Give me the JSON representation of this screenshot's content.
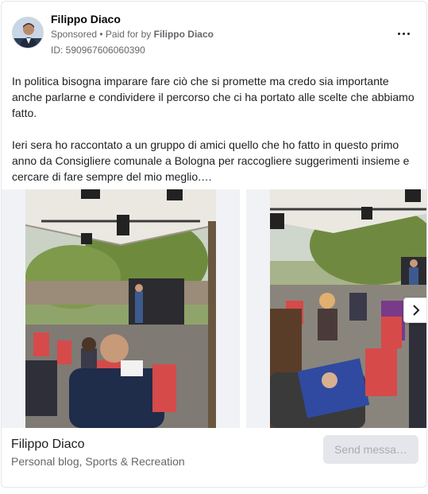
{
  "header": {
    "page_name": "Filippo Diaco",
    "sponsored_label": "Sponsored",
    "separator": " • ",
    "paid_for_prefix": "Paid for by ",
    "paid_for_name": "Filippo Diaco",
    "ad_id": "ID: 590967606060390",
    "more_icon": "more-horizontal-icon"
  },
  "post": {
    "paragraph_1": "In politica bisogna imparare fare ciò che si promette ma credo sia importante anche parlarne e condividere il percorso che ci ha portato alle scelte che abbiamo fatto.",
    "paragraph_2": "Ieri sera ho raccontato a un gruppo di amici quello che ho fatto in questo primo anno da Consigliere comunale a Bologna per raccogliere suggerimenti insieme e cercare di fare sempre del mio meglio.…"
  },
  "carousel": {
    "slide_count_visible": 2,
    "next_icon": "chevron-right-icon"
  },
  "footer": {
    "name": "Filippo Diaco",
    "category": "Personal blog, Sports & Recreation",
    "cta_label": "Send messa…"
  },
  "colors": {
    "secondary_text": "#65676b",
    "button_bg": "#e4e6eb",
    "button_text": "#a9acb1"
  }
}
